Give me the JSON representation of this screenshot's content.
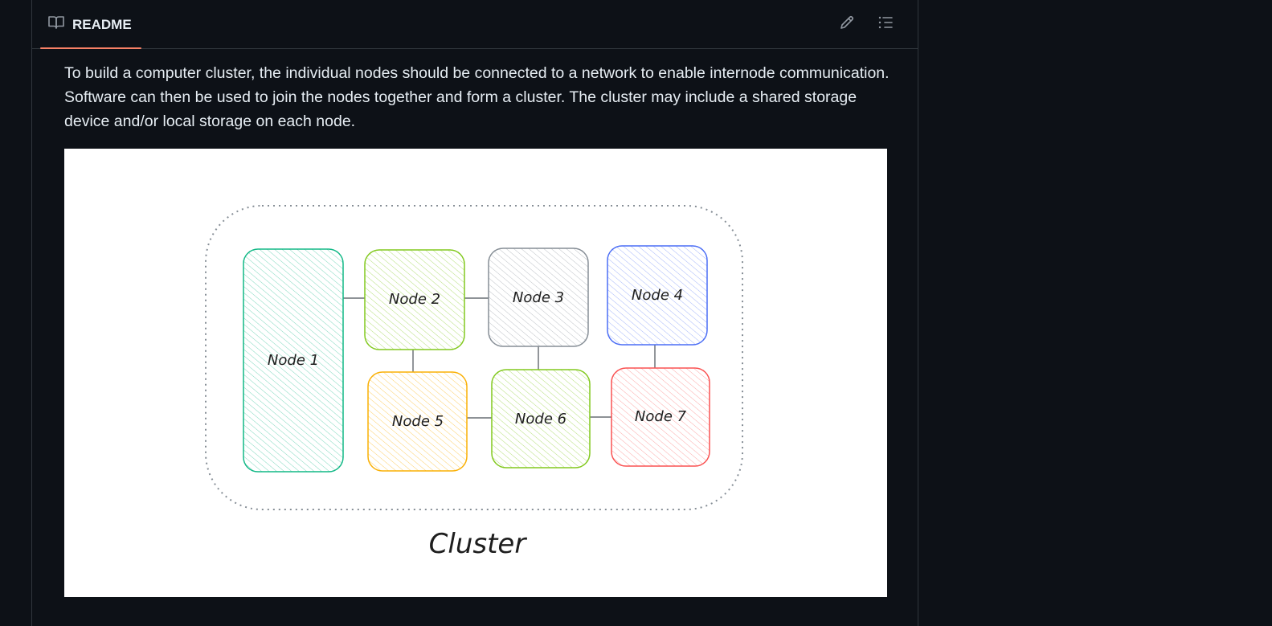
{
  "readme": {
    "tab_label": "README",
    "edit_icon": "pencil-icon",
    "outline_icon": "list-icon"
  },
  "content": {
    "paragraph": "To build a computer cluster, the individual nodes should be connected to a network to enable internode communication. Software can then be used to join the nodes together and form a cluster. The cluster may include a shared storage device and/or local storage on each node."
  },
  "diagram": {
    "caption": "Cluster",
    "nodes": [
      {
        "label": "Node 1",
        "color": "#12b886"
      },
      {
        "label": "Node 2",
        "color": "#82c91e"
      },
      {
        "label": "Node 3",
        "color": "#868e96"
      },
      {
        "label": "Node 4",
        "color": "#4c6ef5"
      },
      {
        "label": "Node 5",
        "color": "#fab005"
      },
      {
        "label": "Node 6",
        "color": "#82c91e"
      },
      {
        "label": "Node 7",
        "color": "#fa5252"
      }
    ]
  },
  "colors": {
    "background": "#0d1117",
    "border": "#30363d",
    "accent_underline": "#f78166",
    "text": "#e6edf3"
  }
}
